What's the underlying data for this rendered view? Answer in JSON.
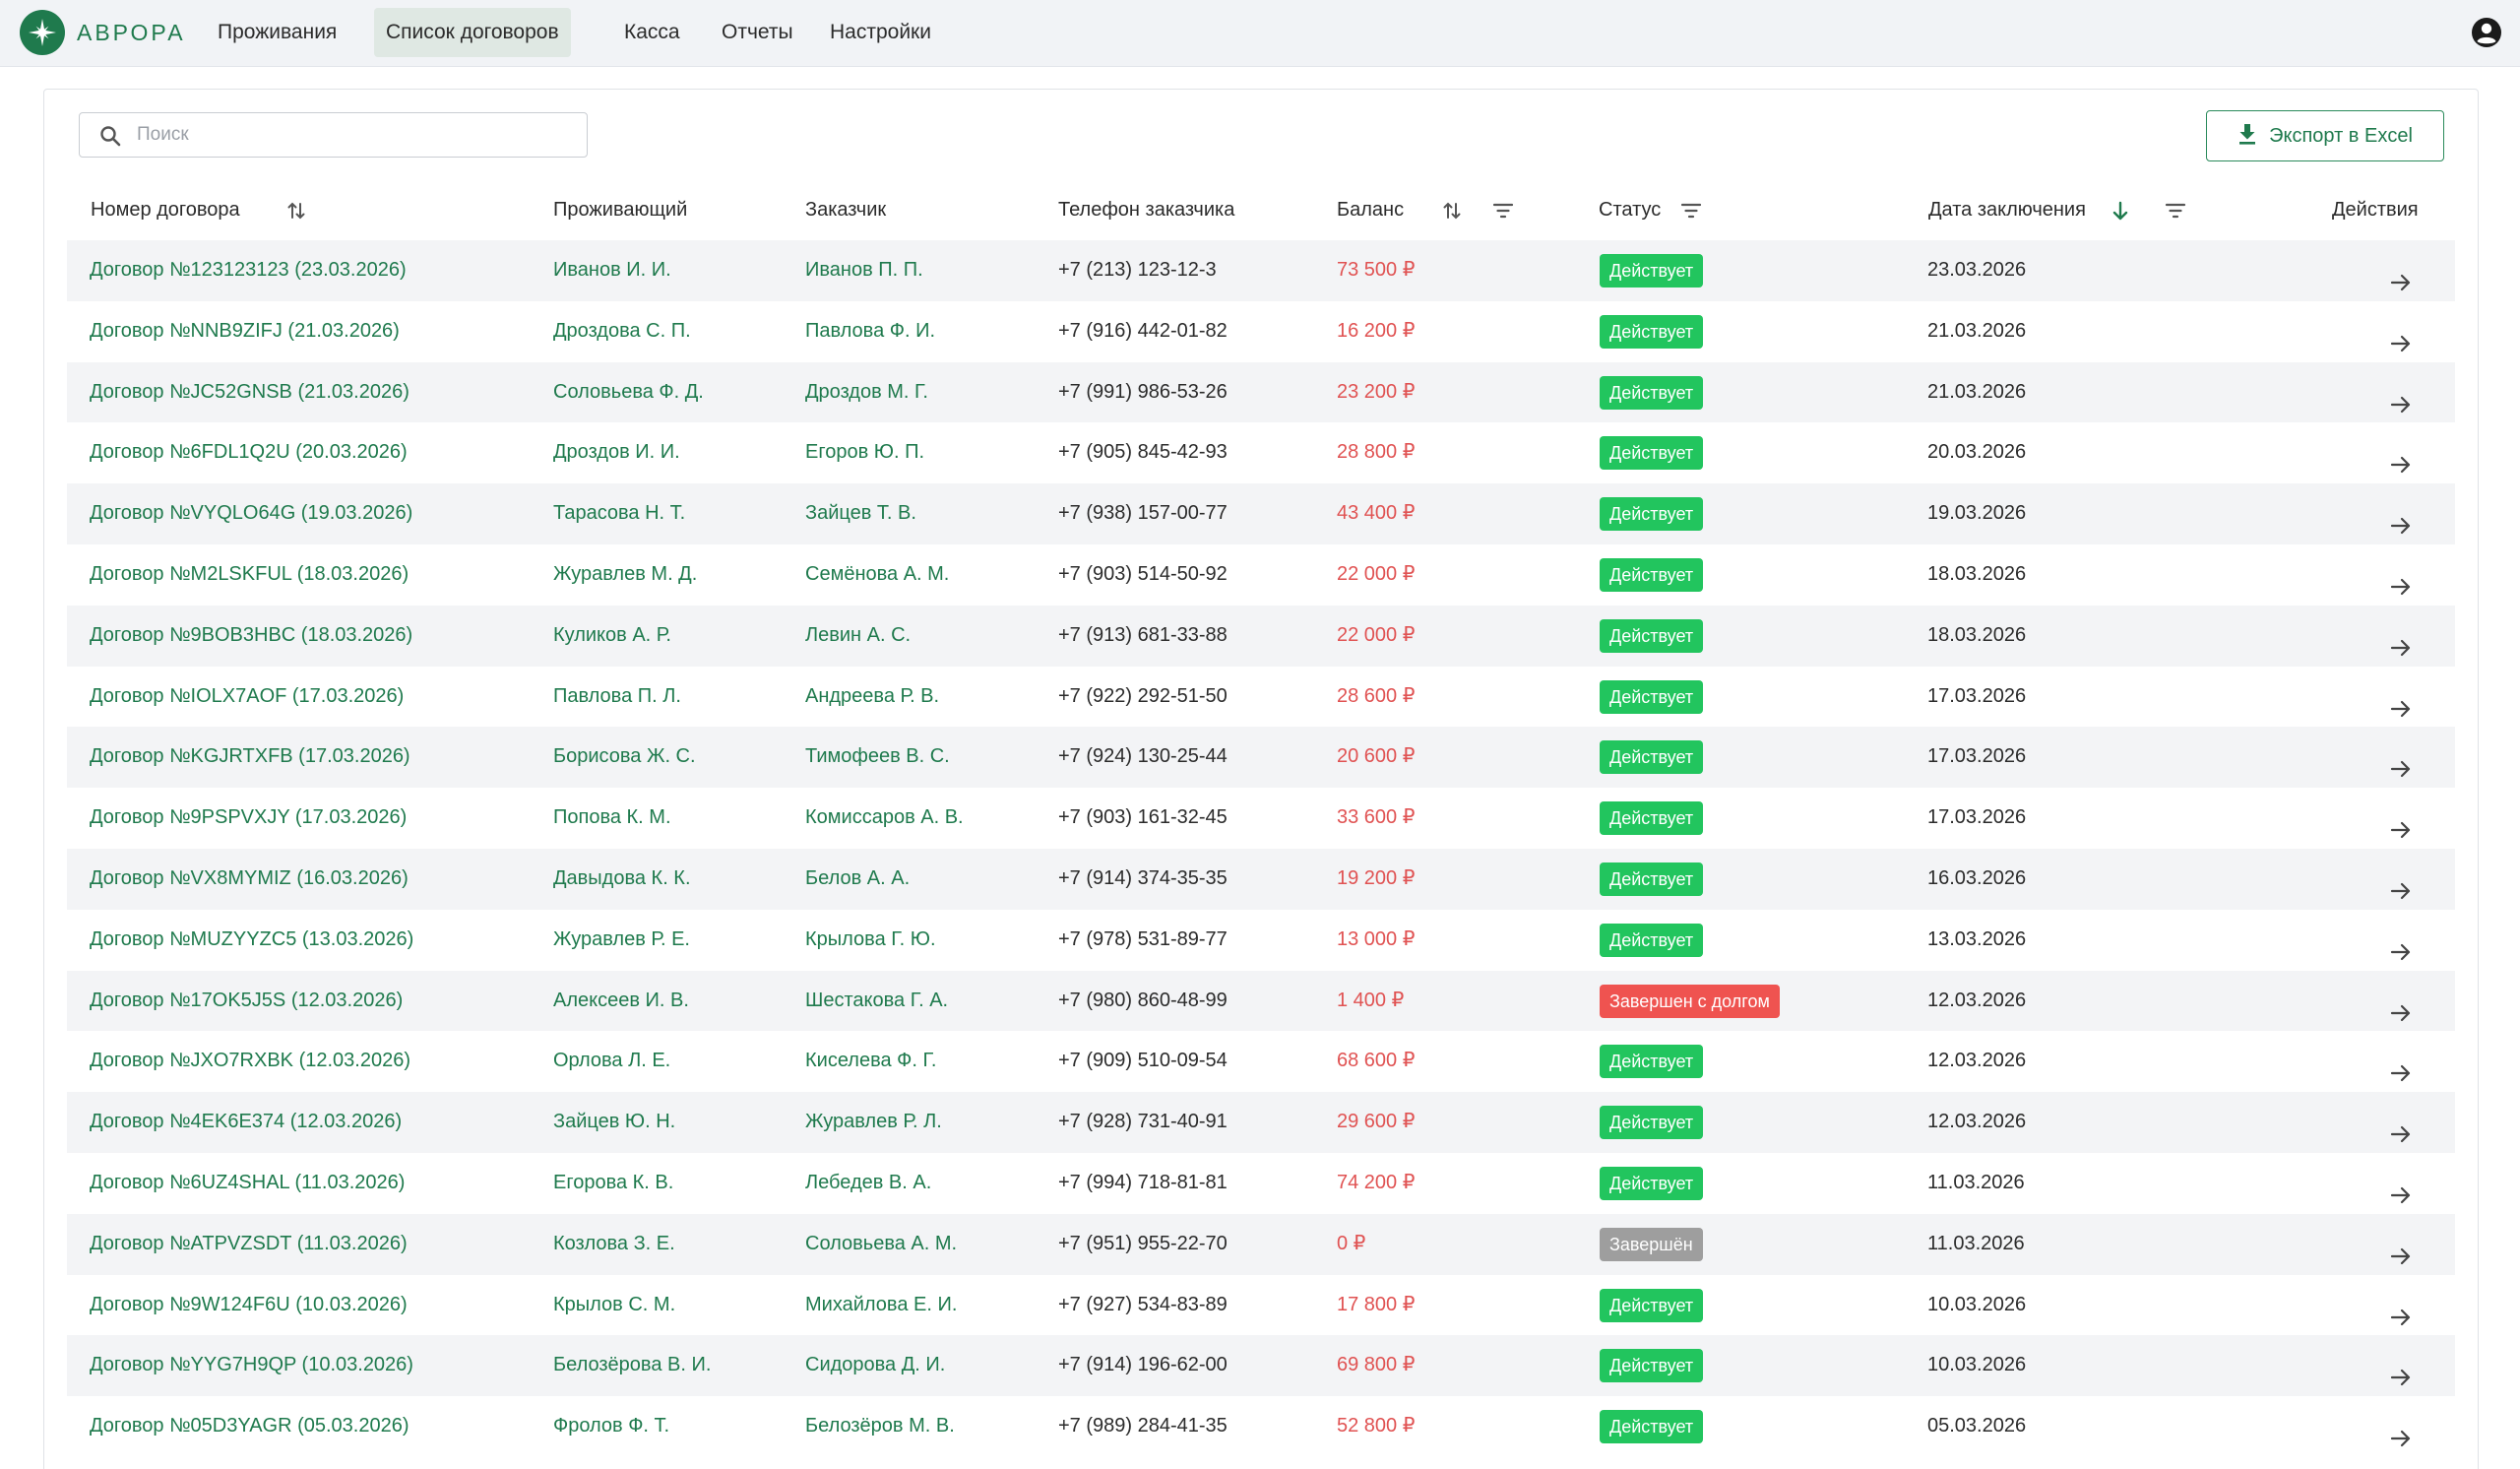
{
  "app": {
    "logo_text": "АВРОРА",
    "brand_color": "#1f7a4d"
  },
  "nav": {
    "items": [
      {
        "label": "Проживания"
      },
      {
        "label": "Список договоров",
        "active": true
      },
      {
        "label": "Касса"
      },
      {
        "label": "Отчеты"
      },
      {
        "label": "Настройки"
      }
    ],
    "user_icon": "account-circle-icon"
  },
  "search": {
    "placeholder": "Поиск",
    "value": ""
  },
  "export": {
    "label": "Экспорт в Excel",
    "icon": "download-icon"
  },
  "table": {
    "columns": {
      "contract": "Номер договора",
      "resident": "Проживающий",
      "customer": "Заказчик",
      "phone": "Телефон заказчика",
      "balance": "Баланс",
      "status": "Статус",
      "date": "Дата заключения",
      "actions": "Действия"
    },
    "status_colors": {
      "Действует": "#22c55e",
      "Завершен с долгом": "#ef5350",
      "Завершён": "#9e9e9e"
    },
    "rows": [
      {
        "contract": "Договор №123123123 (23.03.2026)",
        "resident": "Иванов И. И.",
        "customer": "Иванов П. П.",
        "phone": "+7 (213) 123-12-3",
        "balance": "73 500 ₽",
        "status": "Действует",
        "date": "23.03.2026"
      },
      {
        "contract": "Договор №NNB9ZIFJ (21.03.2026)",
        "resident": "Дроздова С. П.",
        "customer": "Павлова Ф. И.",
        "phone": "+7 (916) 442-01-82",
        "balance": "16 200 ₽",
        "status": "Действует",
        "date": "21.03.2026"
      },
      {
        "contract": "Договор №JC52GNSB (21.03.2026)",
        "resident": "Соловьева Ф. Д.",
        "customer": "Дроздов М. Г.",
        "phone": "+7 (991) 986-53-26",
        "balance": "23 200 ₽",
        "status": "Действует",
        "date": "21.03.2026"
      },
      {
        "contract": "Договор №6FDL1Q2U (20.03.2026)",
        "resident": "Дроздов И. И.",
        "customer": "Егоров Ю. П.",
        "phone": "+7 (905) 845-42-93",
        "balance": "28 800 ₽",
        "status": "Действует",
        "date": "20.03.2026"
      },
      {
        "contract": "Договор №VYQLO64G (19.03.2026)",
        "resident": "Тарасова Н. Т.",
        "customer": "Зайцев Т. В.",
        "phone": "+7 (938) 157-00-77",
        "balance": "43 400 ₽",
        "status": "Действует",
        "date": "19.03.2026"
      },
      {
        "contract": "Договор №M2LSKFUL (18.03.2026)",
        "resident": "Журавлев М. Д.",
        "customer": "Семёнова А. М.",
        "phone": "+7 (903) 514-50-92",
        "balance": "22 000 ₽",
        "status": "Действует",
        "date": "18.03.2026"
      },
      {
        "contract": "Договор №9BOB3HBC (18.03.2026)",
        "resident": "Куликов А. Р.",
        "customer": "Левин А. С.",
        "phone": "+7 (913) 681-33-88",
        "balance": "22 000 ₽",
        "status": "Действует",
        "date": "18.03.2026"
      },
      {
        "contract": "Договор №IOLX7AOF (17.03.2026)",
        "resident": "Павлова П. Л.",
        "customer": "Андреева Р. В.",
        "phone": "+7 (922) 292-51-50",
        "balance": "28 600 ₽",
        "status": "Действует",
        "date": "17.03.2026"
      },
      {
        "contract": "Договор №KGJRTXFB (17.03.2026)",
        "resident": "Борисова Ж. С.",
        "customer": "Тимофеев В. С.",
        "phone": "+7 (924) 130-25-44",
        "balance": "20 600 ₽",
        "status": "Действует",
        "date": "17.03.2026"
      },
      {
        "contract": "Договор №9PSPVXJY (17.03.2026)",
        "resident": "Попова К. М.",
        "customer": "Комиссаров А. В.",
        "phone": "+7 (903) 161-32-45",
        "balance": "33 600 ₽",
        "status": "Действует",
        "date": "17.03.2026"
      },
      {
        "contract": "Договор №VX8MYMIZ (16.03.2026)",
        "resident": "Давыдова К. К.",
        "customer": "Белов А. А.",
        "phone": "+7 (914) 374-35-35",
        "balance": "19 200 ₽",
        "status": "Действует",
        "date": "16.03.2026"
      },
      {
        "contract": "Договор №MUZYYZC5 (13.03.2026)",
        "resident": "Журавлев Р. Е.",
        "customer": "Крылова Г. Ю.",
        "phone": "+7 (978) 531-89-77",
        "balance": "13 000 ₽",
        "status": "Действует",
        "date": "13.03.2026"
      },
      {
        "contract": "Договор №17OK5J5S (12.03.2026)",
        "resident": "Алексеев И. В.",
        "customer": "Шестакова Г. А.",
        "phone": "+7 (980) 860-48-99",
        "balance": "1 400 ₽",
        "status": "Завершен с долгом",
        "date": "12.03.2026"
      },
      {
        "contract": "Договор №JXO7RXBK (12.03.2026)",
        "resident": "Орлова Л. Е.",
        "customer": "Киселева Ф. Г.",
        "phone": "+7 (909) 510-09-54",
        "balance": "68 600 ₽",
        "status": "Действует",
        "date": "12.03.2026"
      },
      {
        "contract": "Договор №4EK6E374 (12.03.2026)",
        "resident": "Зайцев Ю. Н.",
        "customer": "Журавлев Р. Л.",
        "phone": "+7 (928) 731-40-91",
        "balance": "29 600 ₽",
        "status": "Действует",
        "date": "12.03.2026"
      },
      {
        "contract": "Договор №6UZ4SHAL (11.03.2026)",
        "resident": "Егорова К. В.",
        "customer": "Лебедев В. А.",
        "phone": "+7 (994) 718-81-81",
        "balance": "74 200 ₽",
        "status": "Действует",
        "date": "11.03.2026"
      },
      {
        "contract": "Договор №ATPVZSDT (11.03.2026)",
        "resident": "Козлова З. Е.",
        "customer": "Соловьева А. М.",
        "phone": "+7 (951) 955-22-70",
        "balance": "0 ₽",
        "status": "Завершён",
        "date": "11.03.2026"
      },
      {
        "contract": "Договор №9W124F6U (10.03.2026)",
        "resident": "Крылов С. М.",
        "customer": "Михайлова Е. И.",
        "phone": "+7 (927) 534-83-89",
        "balance": "17 800 ₽",
        "status": "Действует",
        "date": "10.03.2026"
      },
      {
        "contract": "Договор №YYG7H9QP (10.03.2026)",
        "resident": "Белозёрова В. И.",
        "customer": "Сидорова Д. И.",
        "phone": "+7 (914) 196-62-00",
        "balance": "69 800 ₽",
        "status": "Действует",
        "date": "10.03.2026"
      },
      {
        "contract": "Договор №05D3YAGR (05.03.2026)",
        "resident": "Фролов Ф. Т.",
        "customer": "Белозёров М. В.",
        "phone": "+7 (989) 284-41-35",
        "balance": "52 800 ₽",
        "status": "Действует",
        "date": "05.03.2026"
      }
    ]
  }
}
